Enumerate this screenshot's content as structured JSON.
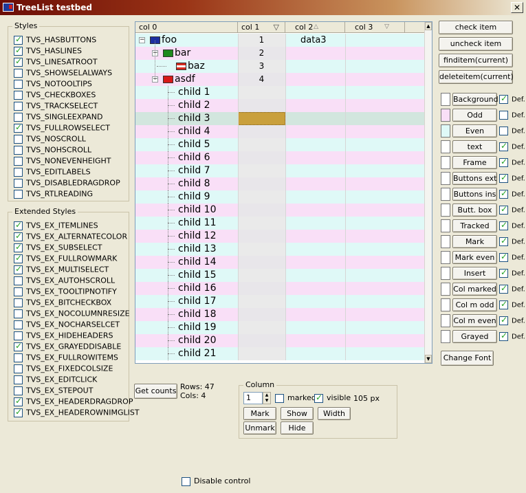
{
  "window": {
    "title": "TreeList testbed",
    "close": "✕"
  },
  "styles": {
    "title": "Styles",
    "items": [
      {
        "label": "TVS_HASBUTTONS",
        "checked": true
      },
      {
        "label": "TVS_HASLINES",
        "checked": true
      },
      {
        "label": "TVS_LINESATROOT",
        "checked": true
      },
      {
        "label": "TVS_SHOWSELALWAYS",
        "checked": false
      },
      {
        "label": "TVS_NOTOOLTIPS",
        "checked": false
      },
      {
        "label": "TVS_CHECKBOXES",
        "checked": false
      },
      {
        "label": "TVS_TRACKSELECT",
        "checked": false
      },
      {
        "label": "TVS_SINGLEEXPAND",
        "checked": false
      },
      {
        "label": "TVS_FULLROWSELECT",
        "checked": true
      },
      {
        "label": "TVS_NOSCROLL",
        "checked": false
      },
      {
        "label": "TVS_NOHSCROLL",
        "checked": false
      },
      {
        "label": "TVS_NONEVENHEIGHT",
        "checked": false
      },
      {
        "label": "TVS_EDITLABELS",
        "checked": false
      },
      {
        "label": "TVS_DISABLEDRAGDROP",
        "checked": false
      },
      {
        "label": "TVS_RTLREADING",
        "checked": false
      }
    ]
  },
  "ext_styles": {
    "title": "Extended Styles",
    "items": [
      {
        "label": "TVS_EX_ITEMLINES",
        "checked": true
      },
      {
        "label": "TVS_EX_ALTERNATECOLOR",
        "checked": true
      },
      {
        "label": "TVS_EX_SUBSELECT",
        "checked": true
      },
      {
        "label": "TVS_EX_FULLROWMARK",
        "checked": true
      },
      {
        "label": "TVS_EX_MULTISELECT",
        "checked": true
      },
      {
        "label": "TVS_EX_AUTOHSCROLL",
        "checked": false
      },
      {
        "label": "TVS_EX_TOOLTIPNOTIFY",
        "checked": false
      },
      {
        "label": "TVS_EX_BITCHECKBOX",
        "checked": false
      },
      {
        "label": "TVS_EX_NOCOLUMNRESIZE",
        "checked": false
      },
      {
        "label": "TVS_EX_NOCHARSELCET",
        "checked": false
      },
      {
        "label": "TVS_EX_HIDEHEADERS",
        "checked": false
      },
      {
        "label": "TVS_EX_GRAYEDDISABLE",
        "checked": true
      },
      {
        "label": "TVS_EX_FULLROWITEMS",
        "checked": false
      },
      {
        "label": "TVS_EX_FIXEDCOLSIZE",
        "checked": false
      },
      {
        "label": "TVS_EX_EDITCLICK",
        "checked": false
      },
      {
        "label": "TVS_EX_STEPOUT",
        "checked": false
      },
      {
        "label": "TVS_EX_HEADERDRAGDROP",
        "checked": true
      },
      {
        "label": "TVS_EX_HEADEROWNIMGLIST",
        "checked": true
      }
    ]
  },
  "tree": {
    "columns": [
      {
        "label": "col 0"
      },
      {
        "label": "col 1",
        "icon": "filter-icon"
      },
      {
        "label": "col 2",
        "icon": "sort-up-icon"
      },
      {
        "label": "col 3",
        "icon": "sort-down-icon"
      }
    ],
    "rows": [
      {
        "label": "foo",
        "col1": "1",
        "col2": "data3",
        "icon": "flag-icon-blue"
      },
      {
        "label": "bar",
        "col1": "2",
        "col2": "",
        "icon": "flag-icon-green"
      },
      {
        "label": "baz",
        "col1": "3",
        "col2": "",
        "icon": "flag-icon-austria"
      },
      {
        "label": "asdf",
        "col1": "4",
        "col2": "",
        "icon": "flag-icon-red"
      },
      {
        "label": "child 1",
        "col1": "",
        "col2": ""
      },
      {
        "label": "child 2",
        "col1": "",
        "col2": ""
      },
      {
        "label": "child 3",
        "col1": "",
        "col2": ""
      },
      {
        "label": "child 4",
        "col1": "",
        "col2": ""
      },
      {
        "label": "child 5",
        "col1": "",
        "col2": ""
      },
      {
        "label": "child 6",
        "col1": "",
        "col2": ""
      },
      {
        "label": "child 7",
        "col1": "",
        "col2": ""
      },
      {
        "label": "child 8",
        "col1": "",
        "col2": ""
      },
      {
        "label": "child 9",
        "col1": "",
        "col2": ""
      },
      {
        "label": "child 10",
        "col1": "",
        "col2": ""
      },
      {
        "label": "child 11",
        "col1": "",
        "col2": ""
      },
      {
        "label": "child 12",
        "col1": "",
        "col2": ""
      },
      {
        "label": "child 13",
        "col1": "",
        "col2": ""
      },
      {
        "label": "child 14",
        "col1": "",
        "col2": ""
      },
      {
        "label": "child 15",
        "col1": "",
        "col2": ""
      },
      {
        "label": "child 16",
        "col1": "",
        "col2": ""
      },
      {
        "label": "child 17",
        "col1": "",
        "col2": ""
      },
      {
        "label": "child 18",
        "col1": "",
        "col2": ""
      },
      {
        "label": "child 19",
        "col1": "",
        "col2": ""
      },
      {
        "label": "child 20",
        "col1": "",
        "col2": ""
      },
      {
        "label": "child 21",
        "col1": "",
        "col2": ""
      }
    ],
    "colors": {
      "odd": "#f9dff7",
      "even": "#dff9f7",
      "tracked": "#c9a03c",
      "selected": "#d2e6de"
    }
  },
  "actions": {
    "check_item": "check item",
    "uncheck_item": "uncheck item",
    "finditem": "finditem(current)",
    "deleteitem": "deleteitem(current)"
  },
  "colors": {
    "def_label": "Def.",
    "items": [
      {
        "label": "Background",
        "swatch": "#ffffff",
        "def": true
      },
      {
        "label": "Odd",
        "swatch": "#f9dff7",
        "def": false
      },
      {
        "label": "Even",
        "swatch": "#dff9f7",
        "def": false
      },
      {
        "label": "text",
        "swatch": "#ffffff",
        "def": true
      },
      {
        "label": "Frame",
        "swatch": "#ffffff",
        "def": true
      },
      {
        "label": "Buttons ext",
        "swatch": "#ffffff",
        "def": true
      },
      {
        "label": "Buttons ins",
        "swatch": "#ffffff",
        "def": true
      },
      {
        "label": "Butt. box",
        "swatch": "#ffffff",
        "def": true
      },
      {
        "label": "Tracked",
        "swatch": "#ffffff",
        "def": true
      },
      {
        "label": "Mark",
        "swatch": "#ffffff",
        "def": true
      },
      {
        "label": "Mark even",
        "swatch": "#ffffff",
        "def": true
      },
      {
        "label": "Insert",
        "swatch": "#ffffff",
        "def": true
      },
      {
        "label": "Col marked",
        "swatch": "#ffffff",
        "def": true
      },
      {
        "label": "Col m odd",
        "swatch": "#ffffff",
        "def": true
      },
      {
        "label": "Col m even",
        "swatch": "#ffffff",
        "def": true
      },
      {
        "label": "Grayed",
        "swatch": "#ffffff",
        "def": true
      }
    ],
    "change_font": "Change Font"
  },
  "counts": {
    "button": "Get counts",
    "rows": "Rows: 47",
    "cols": "Cols: 4"
  },
  "column_panel": {
    "title": "Column",
    "index": "1",
    "marked_label": "marked",
    "marked": false,
    "visible_label": "visible",
    "visible": true,
    "width": "105 px",
    "mark": "Mark",
    "show": "Show",
    "width_btn": "Width",
    "unmark": "Unmark",
    "hide": "Hide"
  },
  "disable_control": {
    "label": "Disable control",
    "checked": false
  }
}
